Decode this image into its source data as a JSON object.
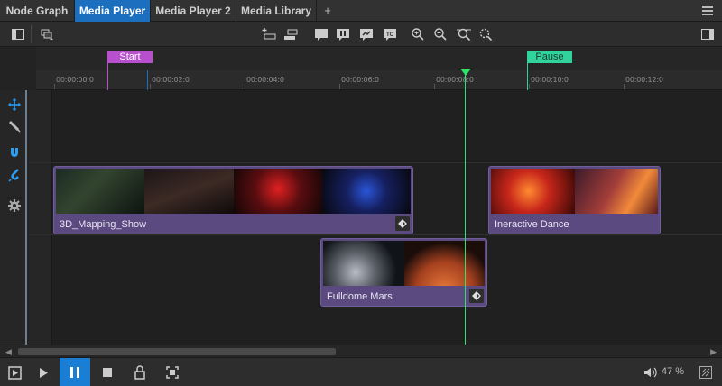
{
  "tabs": [
    {
      "label": "Node Graph",
      "active": false
    },
    {
      "label": "Media Player",
      "active": true
    },
    {
      "label": "Media Player 2",
      "active": false
    },
    {
      "label": "Media Library",
      "active": false
    }
  ],
  "tab_add_label": "+",
  "markers": {
    "start_label": "Start",
    "pause_label": "Pause"
  },
  "ruler": {
    "ticks": [
      "00:00:00:0",
      "00:00:02:0",
      "00:00:04:0",
      "00:00:06:0",
      "00:00:08:0",
      "00:00:10:0",
      "00:00:12:0"
    ]
  },
  "clips": {
    "clip1_label": "3D_Mapping_Show",
    "clip2_label": "Ineractive Dance",
    "clip3_label": "Fulldome Mars"
  },
  "transport": {
    "volume": "47 %"
  },
  "colors": {
    "accent": "#1c6fbf",
    "start_marker": "#b84fcc",
    "pause_marker": "#2fd39b",
    "playhead": "#2ee36a",
    "clip": "#5a4a80"
  }
}
